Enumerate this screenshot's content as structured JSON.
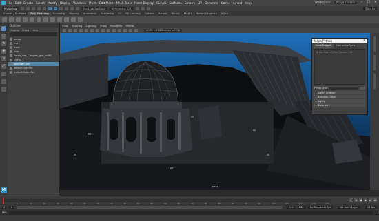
{
  "menubar": {
    "items": [
      "File",
      "Edit",
      "Create",
      "Select",
      "Modify",
      "Display",
      "Windows",
      "Mesh",
      "Edit Mesh",
      "Mesh Tools",
      "Mesh Display",
      "Curves",
      "Surfaces",
      "Deform",
      "UV",
      "Generate",
      "Cache",
      "Arnold",
      "Help"
    ],
    "workspace_label": "Workspace:",
    "workspace_value": "Maya Classic"
  },
  "status_line": {
    "mode": "Modeling",
    "symmetry": "No Live Surface",
    "field": "Symmetry: Off",
    "sign_in": "Sign In"
  },
  "shelf_tabs": [
    "Curves / Surfaces",
    "Poly Modeling",
    "Sculpting",
    "Rigging",
    "Animation",
    "Rendering",
    "FX",
    "FX Caching",
    "Custom",
    "Arnold",
    "Bifrost",
    "MASH",
    "Motion Graphics",
    "XGen"
  ],
  "outliner": {
    "title": "Outliner",
    "menu": [
      "Display",
      "Show",
      "Help"
    ],
    "rows": [
      "persp",
      "top",
      "front",
      "side",
      "Palais_des_Congres_geo_noNS",
      "Lights",
      "spotlight_grp",
      "defaultLightSet",
      "defaultObjectSet"
    ],
    "selected_row": 6
  },
  "viewport_panel": {
    "menu": [
      "View",
      "Shading",
      "Lighting",
      "Show",
      "Renderer",
      "Panels"
    ],
    "camera_field": "ACES 1.0 SDR-video (sRGB)",
    "camera_name": "persp"
  },
  "mash_panel": {
    "title": "Maya Python",
    "tabs": [
      "Code Snippet",
      "Interactive View"
    ],
    "editor_placeholder": "# Use Maya Python Console / OK",
    "style_label": "Preset Style",
    "sections": [
      "Object Creation",
      "Selection, Other",
      "Lights",
      "Materials"
    ]
  },
  "timeline": {
    "ticks": [
      "1",
      "5",
      "10",
      "15",
      "20",
      "25",
      "30",
      "35",
      "40",
      "45",
      "50",
      "55",
      "60",
      "65",
      "70",
      "75",
      "80",
      "85",
      "90",
      "95",
      "100",
      "105",
      "110",
      "115",
      "120"
    ],
    "current_frame": "1"
  },
  "range": {
    "start": "1",
    "inner_start": "1",
    "inner_end": "120",
    "end": "200",
    "no_char_set": "No Character Set",
    "no_anim_layer": "No Anim Layer",
    "fps": "24 fps"
  },
  "command_line": {
    "label": "MEL"
  },
  "help_line": ""
}
